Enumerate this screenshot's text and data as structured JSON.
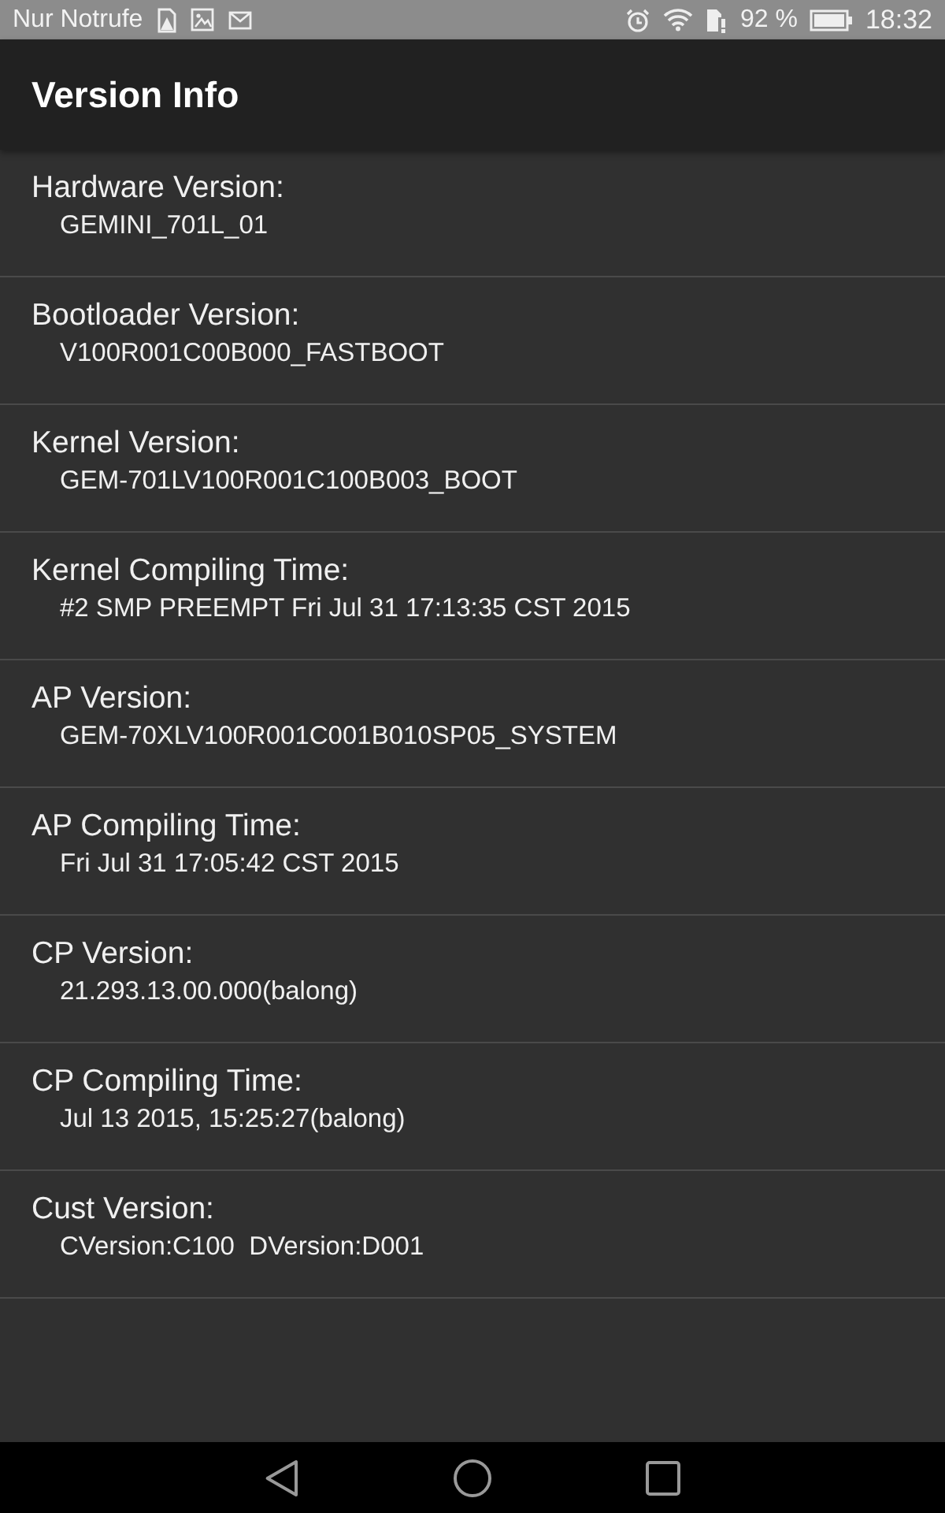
{
  "status_bar": {
    "carrier": "Nur Notrufe",
    "battery": "92 %",
    "time": "18:32"
  },
  "app_bar": {
    "title": "Version Info"
  },
  "items": [
    {
      "label": "Hardware Version:",
      "value": "GEMINI_701L_01"
    },
    {
      "label": "Bootloader Version:",
      "value": "V100R001C00B000_FASTBOOT"
    },
    {
      "label": "Kernel Version:",
      "value": "GEM-701LV100R001C100B003_BOOT"
    },
    {
      "label": "Kernel Compiling Time:",
      "value": "#2 SMP PREEMPT Fri Jul 31 17:13:35 CST 2015"
    },
    {
      "label": "AP Version:",
      "value": "GEM-70XLV100R001C001B010SP05_SYSTEM"
    },
    {
      "label": "AP Compiling Time:",
      "value": "Fri Jul 31 17:05:42 CST 2015"
    },
    {
      "label": "CP Version:",
      "value": "21.293.13.00.000(balong)"
    },
    {
      "label": "CP Compiling Time:",
      "value": "Jul 13 2015, 15:25:27(balong)"
    },
    {
      "label": "Cust Version:",
      "value": "CVersion:C100  DVersion:D001"
    }
  ]
}
